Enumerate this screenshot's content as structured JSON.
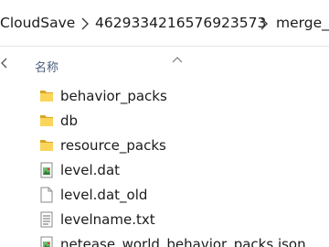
{
  "breadcrumb": {
    "items": [
      {
        "label": "CloudSave"
      },
      {
        "label": "4629334216576923573"
      },
      {
        "label": "merge_c"
      }
    ]
  },
  "columns": {
    "name_label": "名称"
  },
  "files": [
    {
      "name": "behavior_packs",
      "icon": "folder-icon"
    },
    {
      "name": "db",
      "icon": "folder-icon"
    },
    {
      "name": "resource_packs",
      "icon": "folder-icon"
    },
    {
      "name": "level.dat",
      "icon": "image-file-icon"
    },
    {
      "name": "level.dat_old",
      "icon": "blank-file-icon"
    },
    {
      "name": "levelname.txt",
      "icon": "text-file-icon"
    },
    {
      "name": "netease_world_behavior_packs.json",
      "icon": "image-file-icon"
    }
  ],
  "colors": {
    "folder": "#f4c542",
    "folder_dark": "#d9a521",
    "header_text": "#4c607a",
    "text": "#1b1b1b"
  }
}
